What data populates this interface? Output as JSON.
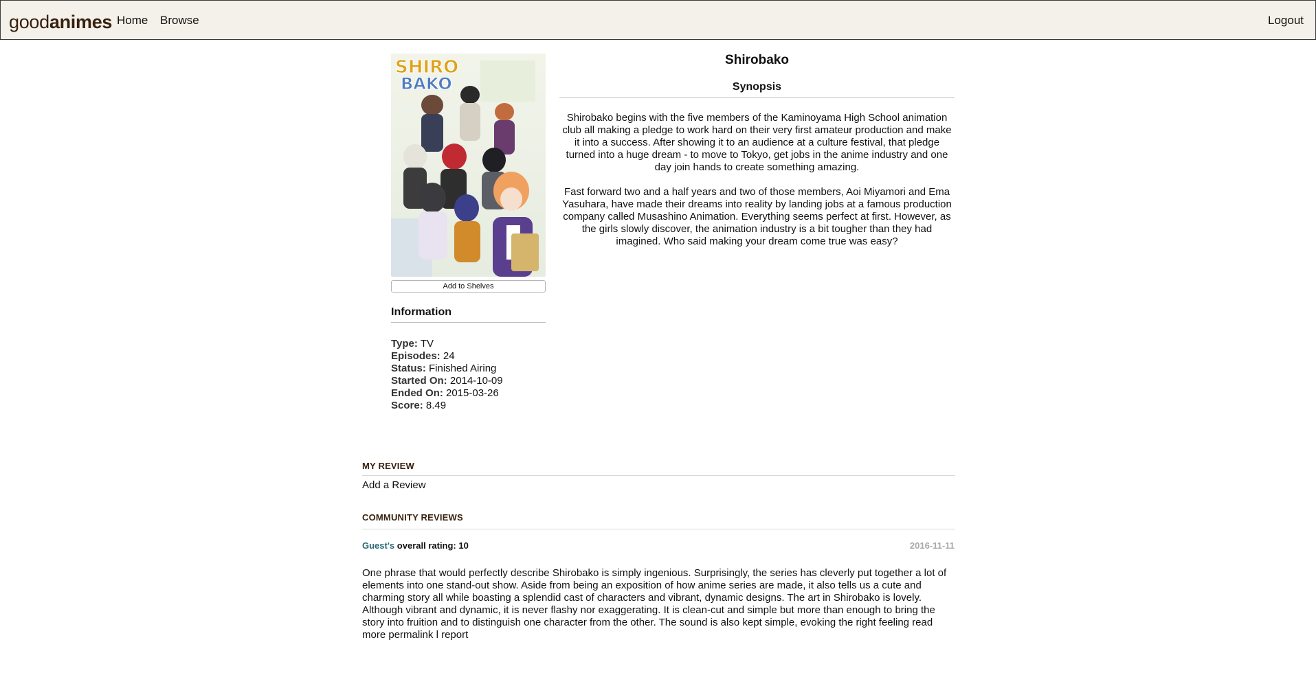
{
  "nav": {
    "logo_light": "good",
    "logo_bold": "animes",
    "home": "Home",
    "browse": "Browse",
    "logout": "Logout"
  },
  "anime": {
    "title": "Shirobako",
    "cover_logo_line1": "SHIRO",
    "cover_logo_line2": "BAKO",
    "add_to_shelves": "Add to Shelves"
  },
  "information": {
    "heading": "Information",
    "rows": [
      {
        "label": "Type:",
        "value": "TV"
      },
      {
        "label": "Episodes:",
        "value": "24"
      },
      {
        "label": "Status:",
        "value": "Finished Airing"
      },
      {
        "label": "Started On:",
        "value": "2014-10-09"
      },
      {
        "label": "Ended On:",
        "value": "2015-03-26"
      },
      {
        "label": "Score:",
        "value": "8.49"
      }
    ]
  },
  "synopsis": {
    "heading": "Synopsis",
    "paragraphs": [
      "Shirobako begins with the five members of the Kaminoyama High School animation club all making a pledge to work hard on their very first amateur production and make it into a success. After showing it to an audience at a culture festival, that pledge turned into a huge dream - to move to Tokyo, get jobs in the anime industry and one day join hands to create something amazing.",
      "Fast forward two and a half years and two of those members, Aoi Miyamori and Ema Yasuhara, have made their dreams into reality by landing jobs at a famous production company called Musashino Animation. Everything seems perfect at first. However, as the girls slowly discover, the animation industry is a bit tougher than they had imagined. Who said making your dream come true was easy?"
    ]
  },
  "my_review": {
    "heading": "MY REVIEW",
    "add_label": "Add a Review"
  },
  "community_reviews": {
    "heading": "COMMUNITY REVIEWS",
    "reviews": [
      {
        "user": "Guest's",
        "rating_label": "overall rating: 10",
        "date": "2016-11-11",
        "body": "One phrase that would perfectly describe Shirobako is simply ingenious. Surprisingly, the series has cleverly put together a lot of elements into one stand-out show. Aside from being an exposition of how anime series are made, it also tells us a cute and charming story all while boasting a splendid cast of characters and vibrant, dynamic designs. The art in Shirobako is lovely. Although vibrant and dynamic, it is never flashy nor exaggerating. It is clean-cut and simple but more than enough to bring the story into fruition and to distinguish one character from the other. The sound is also kept simple, evoking the right feeling",
        "read_more": "read more",
        "permalink": "permalink",
        "separator": "l",
        "report": "report"
      }
    ]
  }
}
